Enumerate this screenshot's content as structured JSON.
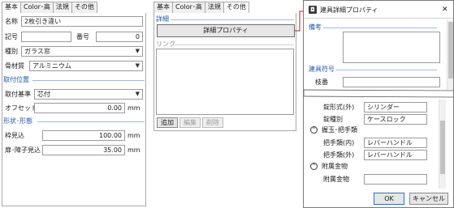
{
  "left_panel": {
    "tabs": [
      "基本",
      "Color･高",
      "法規",
      "その他"
    ],
    "name_label": "名称",
    "name_value": "2枚引き違い",
    "symbol_label": "記号",
    "number_label": "番号",
    "number_value": "0",
    "type_label": "種別",
    "type_value": "ガラス窓",
    "frame_material_label": "骨材質",
    "frame_material_value": "アルミニウム",
    "section_position": "取付位置",
    "mount_base_label": "取付基準",
    "mount_base_value": "芯付",
    "offset_label": "オフセット",
    "offset_value": "0.00",
    "offset_unit": "mm",
    "section_shape": "形状･形態",
    "frame_sight_label": "枠見込",
    "frame_sight_value": "100.00",
    "frame_sight_unit": "mm",
    "sash_sight_label": "扉･障子見込",
    "sash_sight_value": "35.00",
    "sash_sight_unit": "mm"
  },
  "middle_panel": {
    "tabs": [
      "基本",
      "Color･高",
      "法規",
      "その他"
    ],
    "detail_section": "詳細",
    "detail_button": "詳細プロパティ",
    "link_section": "リンク",
    "add_button": "追加",
    "edit_button": "編集",
    "delete_button": "削除"
  },
  "dialog": {
    "title": "建具詳細プロパティ",
    "close_glyph": "✕",
    "remarks_label": "備考",
    "fitting_code_label": "建具符号",
    "frame_number_label": "枝番",
    "cylinder_outer_label": "錠形式(外)",
    "cylinder_outer_value": "シリンダー",
    "lock_type_label": "錠種別",
    "lock_type_value": "ケースロック",
    "handle_group_label": "握玉･把手類",
    "handle_inner_label": "把手類(内)",
    "handle_inner_value": "レバーハンドル",
    "handle_outer_label": "把手類(外)",
    "handle_outer_value": "レバーハンドル",
    "accessory_group_label": "附属金物",
    "accessory_label": "附属金物",
    "ok_button": "OK",
    "cancel_button": "キャンセル"
  },
  "colors": {
    "section_blue": "#1f56b8",
    "connector_red": "#c0181e"
  }
}
